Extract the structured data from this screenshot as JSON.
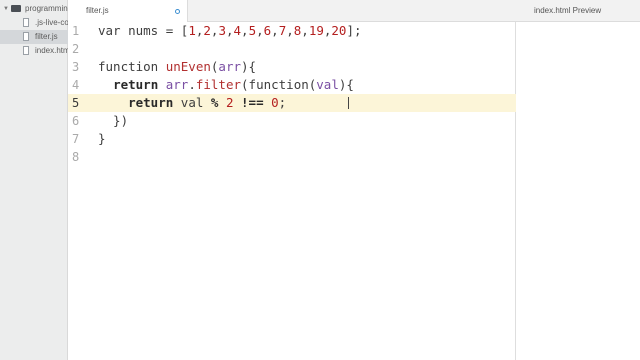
{
  "sidebar": {
    "project_folder": "programming",
    "files": [
      {
        "name": ".js-live-co"
      },
      {
        "name": "filter.js"
      },
      {
        "name": "index.html"
      }
    ]
  },
  "editor": {
    "tab_title": "filter.js",
    "current_line": 5,
    "line_numbers": [
      "1",
      "2",
      "3",
      "4",
      "5",
      "6",
      "7",
      "8"
    ]
  },
  "preview": {
    "title": "index.html Preview"
  }
}
